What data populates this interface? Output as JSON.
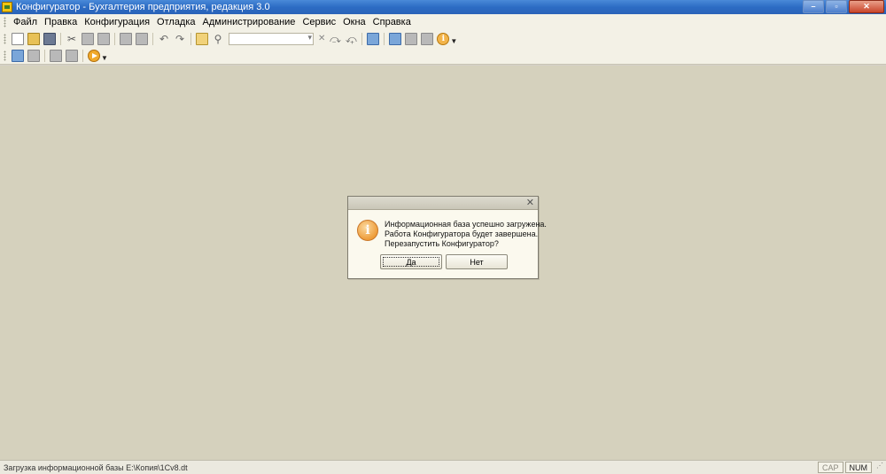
{
  "window": {
    "title": "Конфигуратор - Бухгалтерия предприятия, редакция 3.0",
    "controls": {
      "minimize": "–",
      "maximize": "▫",
      "close": "✕"
    }
  },
  "menu": [
    "Файл",
    "Правка",
    "Конфигурация",
    "Отладка",
    "Администрирование",
    "Сервис",
    "Окна",
    "Справка"
  ],
  "toolbar1": {
    "icons": [
      "new-document-icon",
      "open-folder-icon",
      "save-icon",
      "cut-icon",
      "copy-icon",
      "paste-icon",
      "print-icon",
      "print-preview-icon",
      "undo-icon",
      "redo-icon",
      "find-icon",
      "search-icon",
      "find-next-icon",
      "find-previous-icon",
      "windows-icon",
      "tools-icon",
      "syntax-helper-icon",
      "properties-icon",
      "info-icon"
    ],
    "search_value": ""
  },
  "toolbar2": {
    "icons": [
      "module-icon",
      "config-tree-icon",
      "database-icon",
      "table-icon",
      "run-enterprise-icon"
    ]
  },
  "dialog": {
    "close_glyph": "✕",
    "icon_glyph": "i",
    "lines": [
      "Информационная база успешно загружена.",
      "Работа Конфигуратора будет завершена.",
      "Перезапустить Конфигуратор?"
    ],
    "yes_label": "Да",
    "no_label": "Нет"
  },
  "status": {
    "text": "Загрузка информационной базы E:\\Копия\\1Cv8.dt",
    "cap": "CAP",
    "num": "NUM"
  }
}
